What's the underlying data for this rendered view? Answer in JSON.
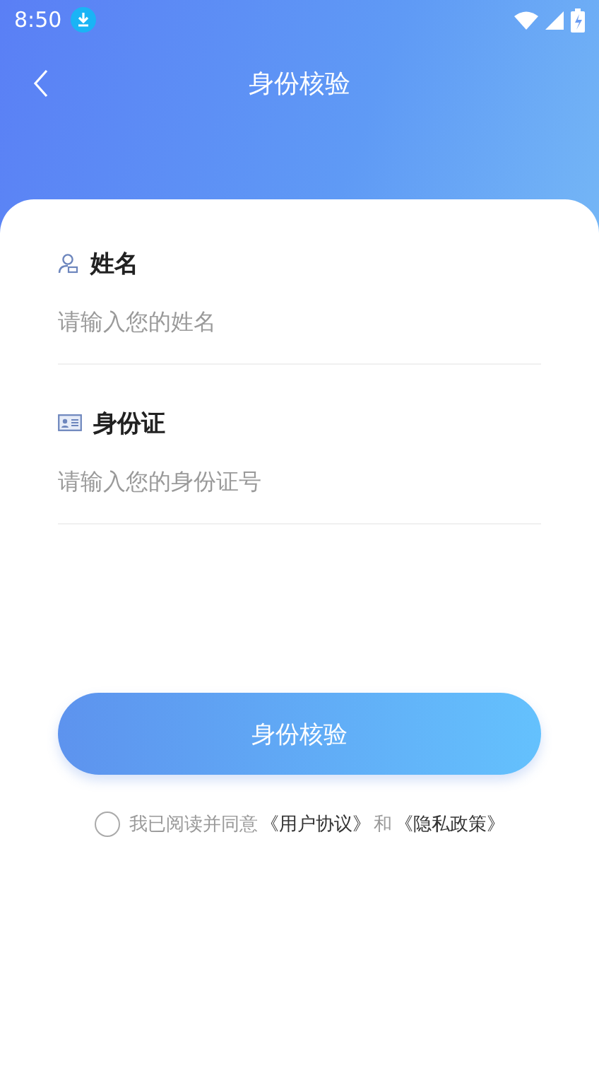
{
  "status_bar": {
    "time": "8:50"
  },
  "nav": {
    "title": "身份核验"
  },
  "fields": [
    {
      "kind": "person",
      "label": "姓名",
      "placeholder": "请输入您的姓名"
    },
    {
      "kind": "card",
      "label": "身份证",
      "placeholder": "请输入您的身份证号"
    }
  ],
  "submit": "身份核验",
  "agreement": {
    "checked": false,
    "parts": [
      {
        "kind": "text",
        "text": "我已阅读并同意"
      },
      {
        "kind": "link",
        "text": "《用户协议》"
      },
      {
        "kind": "text",
        "text": "和"
      },
      {
        "kind": "link",
        "text": "《隐私政策》"
      }
    ]
  }
}
